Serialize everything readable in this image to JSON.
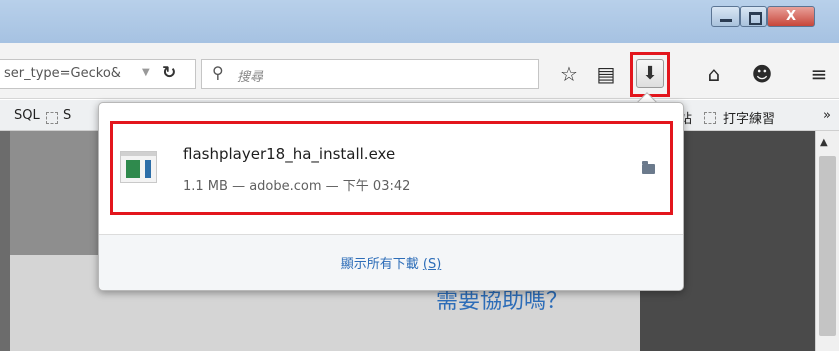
{
  "window": {
    "close_label": "X"
  },
  "navbar": {
    "url_text": "ser_type=Gecko&",
    "search_placeholder": "搜尋"
  },
  "bookmarks": {
    "sql_label": "SQL",
    "s_label": "S",
    "zhan_label": "站",
    "typing_label": "打字練習",
    "more_label": "»"
  },
  "page": {
    "help_text": "需要協助嗎？"
  },
  "download_panel": {
    "items": [
      {
        "filename": "flashplayer18_ha_install.exe",
        "info": "1.1 MB — adobe.com — 下午 03:42"
      }
    ],
    "show_all_label": "顯示所有下載",
    "show_all_key": "(S)"
  },
  "icons": {
    "reload": "reload-icon",
    "search": "search-icon",
    "star": "star-icon",
    "bookmarks": "bookmarks-icon",
    "download": "download-icon",
    "home": "home-icon",
    "smile": "smile-icon",
    "menu": "menu-icon",
    "folder": "folder-icon",
    "file": "file-icon"
  },
  "colors": {
    "highlight": "#e3161d",
    "link": "#2d6db8"
  }
}
